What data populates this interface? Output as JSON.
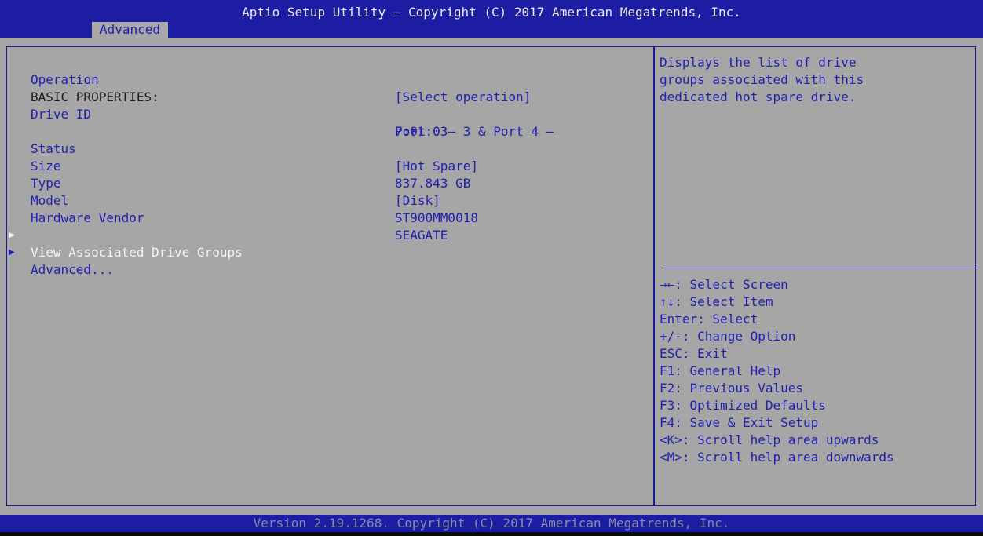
{
  "header": {
    "title": "Aptio Setup Utility – Copyright (C) 2017 American Megatrends, Inc.",
    "tab": "Advanced"
  },
  "colors": {
    "header_bg": "#1d1da3",
    "screen_bg": "#a6a6a6",
    "text_blue": "#1f1fb0",
    "text_white": "#f0f0f0"
  },
  "settings": {
    "operation": {
      "label": "Operation",
      "value": "[Select operation]"
    },
    "basic_properties": "BASIC PROPERTIES:",
    "drive_id": {
      "label": "Drive ID",
      "value_line1": "Port 0 – 3 & Port 4 –",
      "value_line2": "7:01:03"
    },
    "status": {
      "label": "Status",
      "value": "[Hot Spare]"
    },
    "size": {
      "label": "Size",
      "value": "837.843 GB"
    },
    "type": {
      "label": "Type",
      "value": "[Disk]"
    },
    "model": {
      "label": "Model",
      "value": "ST900MM0018"
    },
    "vendor": {
      "label": "Hardware Vendor",
      "value": "SEAGATE"
    },
    "view_groups": {
      "label": "View Associated Drive Groups",
      "arrow": "▶"
    },
    "advanced": {
      "label": "Advanced...",
      "arrow": "▶"
    }
  },
  "help": {
    "lines": [
      "Displays the list of drive",
      "groups associated with this",
      "dedicated hot spare drive."
    ]
  },
  "keys": [
    "→←: Select Screen",
    "↑↓: Select Item",
    "Enter: Select",
    "+/-: Change Option",
    "ESC: Exit",
    "F1: General Help",
    "F2: Previous Values",
    "F3: Optimized Defaults",
    "F4: Save & Exit Setup",
    "<K>: Scroll help area upwards",
    "<M>: Scroll help area downwards"
  ],
  "footer": {
    "text": "Version 2.19.1268. Copyright (C) 2017 American Megatrends, Inc."
  }
}
